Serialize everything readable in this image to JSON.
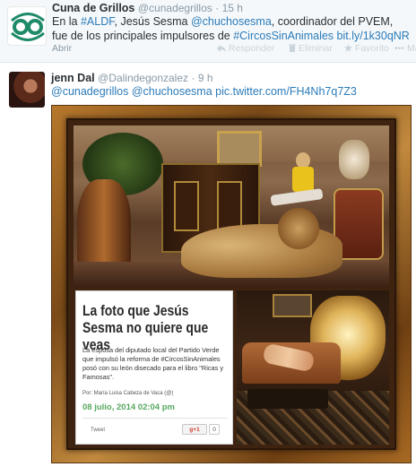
{
  "tweet1": {
    "name": "Cuna de Grillos",
    "handle": "@cunadegrillos",
    "time": "· 15 h",
    "text_parts": {
      "p1": "En la ",
      "hashtag1": "#ALDF",
      "p2": ", Jesús Sesma ",
      "mention1": "@chuchosesma",
      "p3": ", coordinador del PVEM, fue de los principales impulsores de ",
      "hashtag2": "#CircosSinAnimales",
      "p4": " ",
      "link": "bit.ly/1k30qNR"
    },
    "actions": {
      "open": "Abrir",
      "reply": "Responder",
      "delete": "Eliminar",
      "favorite": "Favorito",
      "more": "Más"
    }
  },
  "tweet2": {
    "name": "jenn Dal",
    "handle": "@Dalindegonzalez",
    "time": "· 9 h",
    "mention1": "@cunadegrillos",
    "mention2": "@chuchosesma",
    "pic_link": "pic.twitter.com/FH4Nh7q7Z3"
  },
  "article": {
    "title": "La foto que Jesús Sesma no quiere que veas",
    "body": "La esposa del diputado local del Partido Verde que impulsó la reforma de #CircosSinAnimales posó con su león disecado para el libro \"Ricas y Famosas\".",
    "author": "Por: María Luisa Cabeza de Vaca (@)",
    "date": "08 julio, 2014 02:04 pm",
    "tweet_label": "Tweet",
    "gplus_label": "g+1",
    "gplus_count": "0"
  },
  "colors": {
    "link": "#2b7bb9",
    "meta": "#8899a6",
    "highlight_bg": "#f5f8fa",
    "article_date": "#57a85f",
    "frame_gold": "#b7782c"
  },
  "icons": {
    "avatar1": "cuna-de-grillos-logo",
    "reply": "reply-icon",
    "delete": "trash-icon",
    "favorite": "star-icon",
    "more": "more-icon"
  }
}
